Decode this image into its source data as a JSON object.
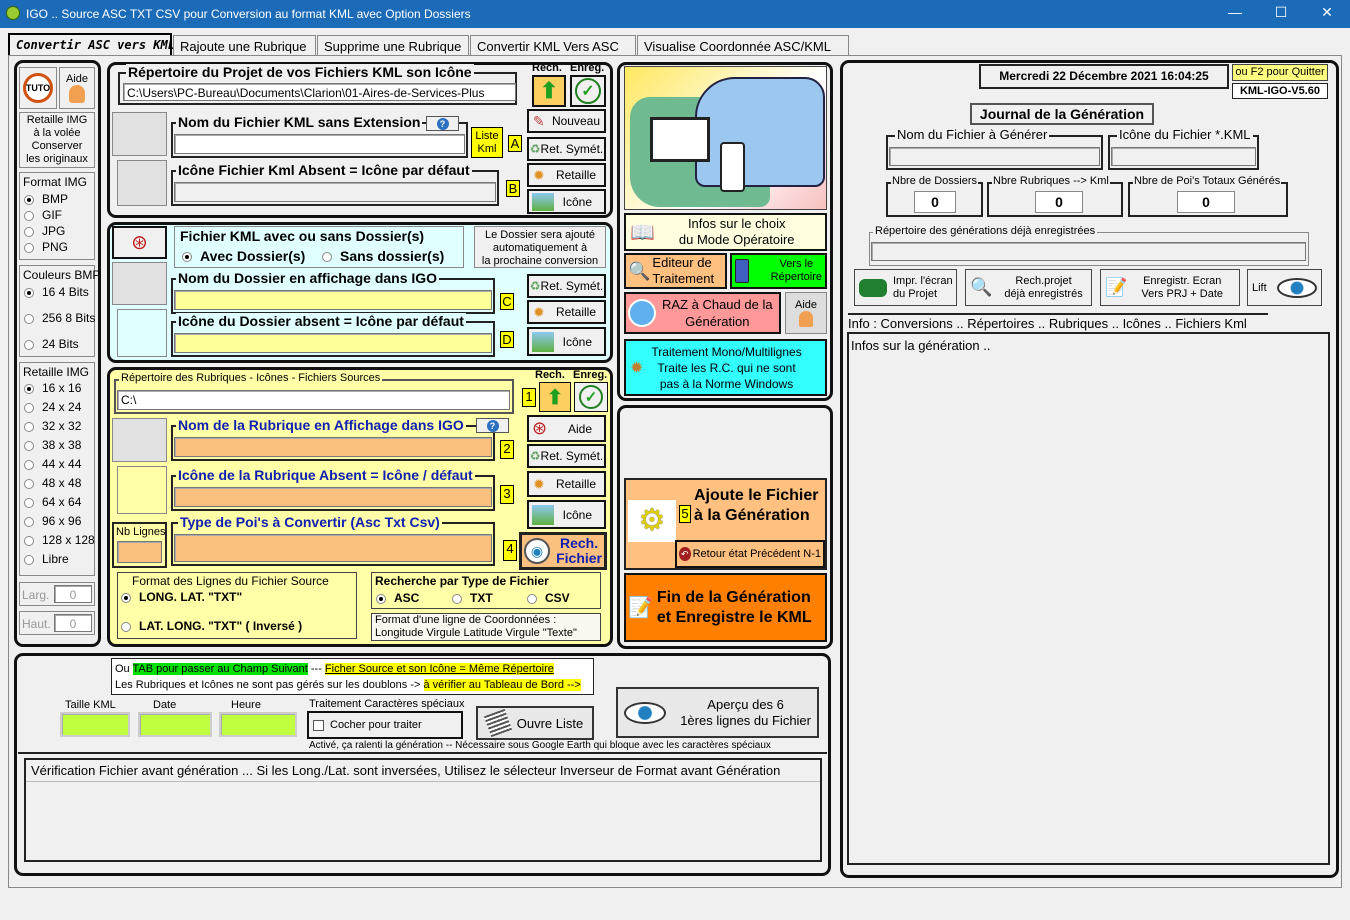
{
  "window": {
    "title": "IGO .. Source ASC TXT CSV pour Conversion au format KML avec Option Dossiers",
    "minimize": "—",
    "maximize": "☐",
    "close": "✕"
  },
  "tabs": [
    "Convertir ASC vers KML",
    "Rajoute une Rubrique",
    "Supprime une Rubrique",
    "Convertir KML Vers ASC",
    "Visualise Coordonnée  ASC/KML"
  ],
  "left": {
    "tuto": "TUTO",
    "aide": "Aide",
    "retaille_note": [
      "Retaille IMG",
      "à la volée",
      "Conserver",
      "les originaux"
    ],
    "format_title": "Format IMG",
    "formats": [
      "BMP",
      "GIF",
      "JPG",
      "PNG"
    ],
    "format_selected": "BMP",
    "colors_title": "Couleurs BMP",
    "colors": [
      "16 4 Bits",
      "256 8 Bits",
      "24 Bits"
    ],
    "color_selected": "16 4 Bits",
    "resize_title": "Retaille IMG",
    "sizes": [
      "16 x 16",
      "24 x 24",
      "32 x 32",
      "38 x 38",
      "44 x 44",
      "48 x 48",
      "64 x 64",
      "96 x 96",
      "128 x 128",
      "Libre"
    ],
    "size_selected": "16 x 16",
    "larg_label": "Larg.",
    "larg_value": "0",
    "haut_label": "Haut.",
    "haut_value": "0"
  },
  "project": {
    "dir_label": "Répertoire du Projet de vos Fichiers KML son Icône",
    "dir_value": "C:\\Users\\PC-Bureau\\Documents\\Clarion\\01-Aires-de-Services-Plus",
    "rech": "Rech.",
    "enreg": "Enreg.",
    "kml_name_label": "Nom du Fichier KML sans Extension",
    "kml_name_value": "",
    "liste_kml": [
      "Liste",
      "Kml"
    ],
    "tag_a": "A",
    "icon_label": "Icône Fichier Kml Absent = Icône par défaut",
    "icon_value": "",
    "tag_b": "B",
    "nouveau": "Nouveau",
    "ret_symet": "Ret. Symét.",
    "retaille": "Retaille",
    "icone": "Icône"
  },
  "dossier": {
    "title": "Fichier KML avec ou sans Dossier(s)",
    "with": "Avec Dossier(s)",
    "without": "Sans dossier(s)",
    "selected": "with",
    "note": [
      "Le Dossier sera ajouté",
      "automatiquement à",
      "la prochaine conversion"
    ],
    "name_label": "Nom du Dossier en affichage dans IGO",
    "name_value": "",
    "tag_c": "C",
    "icon_label": "Icône du Dossier   absent = Icône par défaut",
    "icon_value": "",
    "tag_d": "D",
    "ret_symet": "Ret. Symét.",
    "retaille": "Retaille",
    "icone": "Icône"
  },
  "rubrique": {
    "dir_label": "Répertoire des Rubriques - Icônes - Fichiers Sources",
    "dir_value": "C:\\",
    "tag_1": "1",
    "rech": "Rech.",
    "enreg": "Enreg.",
    "name_label": "Nom de la Rubrique en Affichage dans IGO",
    "name_value": "",
    "tag_2": "2",
    "icon_label": "Icône de la Rubrique  Absent = Icône / défaut",
    "icon_value": "",
    "tag_3": "3",
    "type_label": "Type de Poi's à Convertir (Asc Txt Csv)",
    "type_value": "",
    "tag_4": "4",
    "nb_lignes": "Nb Lignes",
    "nb_value": "",
    "aide": "Aide",
    "ret_symet": "Ret. Symét.",
    "retaille": "Retaille",
    "icone": "Icône",
    "rech_fichier": [
      "Rech.",
      "Fichier"
    ],
    "format_title": "Format des Lignes du Fichier Source",
    "format_opt1": "LONG.  LAT.   \"TXT\"",
    "format_opt2": "LAT.  LONG.   \"TXT\"   ( Inversé )",
    "format_selected": "opt1",
    "search_title": "Recherche par Type de   Fichier",
    "search_types": [
      "ASC",
      "TXT",
      "CSV"
    ],
    "search_selected": "ASC",
    "coord_note": [
      "Format d'une ligne de Coordonnées :",
      "Longitude Virgule Latitude Virgule \"Texte\""
    ]
  },
  "middle": {
    "infos_choix": [
      "Infos sur le choix",
      "du Mode Opératoire"
    ],
    "editeur": [
      "Editeur de",
      "Traitement"
    ],
    "vers_rep": [
      "Vers le",
      "Répertoire"
    ],
    "raz": [
      "RAZ à Chaud de la",
      "Génération"
    ],
    "aide": "Aide",
    "mono": [
      "Traitement Mono/Multilignes",
      "Traite les R.C. qui ne sont",
      "pas à la Norme Windows"
    ],
    "ajoute": [
      "Ajoute le Fichier",
      "à la Génération"
    ],
    "tag_5": "5",
    "retour": "Retour état Précédent N-1",
    "fin": [
      "Fin de la Génération",
      "et Enregistre le KML"
    ]
  },
  "right": {
    "datetime": "Mercredi 22 Décembre 2021   16:04:25",
    "quit": "ou F2 pour Quitter",
    "version": "KML-IGO-V5.60",
    "journal": "Journal de la Génération",
    "file_label": "Nom du Fichier à Générer",
    "file_value": "",
    "icon_label": "Icône du Fichier *.KML",
    "icon_value": "",
    "dossiers_label": "Nbre de Dossiers",
    "dossiers": "0",
    "rubriques_label": "Nbre Rubriques --> Kml",
    "rubriques": "0",
    "pois_label": "Nbre de Poi's Totaux Générés",
    "pois": "0",
    "gen_dir_label": "Répertoire des générations déjà enregistrées",
    "gen_dir_value": "",
    "impr": [
      "Impr. l'écran",
      "du Projet"
    ],
    "rech_proj": [
      "Rech.projet",
      "déjà enregistrés"
    ],
    "enreg_ecran": [
      "Enregistr. Ecran",
      "Vers PRJ + Date"
    ],
    "lift": "Lift",
    "info_line": "Info :  Conversions .. Répertoires .. Rubriques .. Icônes .. Fichiers Kml",
    "info_text": "Infos sur la génération .."
  },
  "bottom": {
    "hint1_pre": "Ou ",
    "hint1_tab": "TAB  pour passer au Champ Suivant",
    "hint1_sep": " --- ",
    "hint1_link": "Ficher Source et son Icône = Même Répertoire",
    "hint2_pre": "Les Rubriques et Icônes ne sont pas gérés sur les doublons -> ",
    "hint2_hl": "à vérifier au Tableau de Bord -->",
    "taille_label": "Taille KML",
    "taille_value": "",
    "date_label": "Date",
    "date_value": "",
    "heure_label": "Heure",
    "heure_value": "",
    "special_title": "Traitement Caractères spéciaux",
    "special_check": "Cocher pour traiter",
    "special_checked": false,
    "ouvre": "Ouvre Liste",
    "apercu": [
      "Aperçu des 6",
      "1ères lignes du Fichier"
    ],
    "special_note": "Activé, ça ralenti la génération -- Nécessaire sous Google Earth qui bloque avec les caractères spéciaux",
    "verif": "Vérification Fichier avant génération ...  Si les Long./Lat. sont inversées,  Utilisez  le sélecteur Inverseur de Format avant Génération"
  },
  "colors": {
    "titlebar": "#1c6bb8",
    "yellow_input": "#ffff99",
    "orange_input": "#fbbf80",
    "cyan_panel": "#e0ffff",
    "yellow_panel": "#ffffa8",
    "fin": "#ff8000",
    "raz": "#ff9999",
    "green": "#00ff00",
    "cyan": "#33ffff"
  }
}
